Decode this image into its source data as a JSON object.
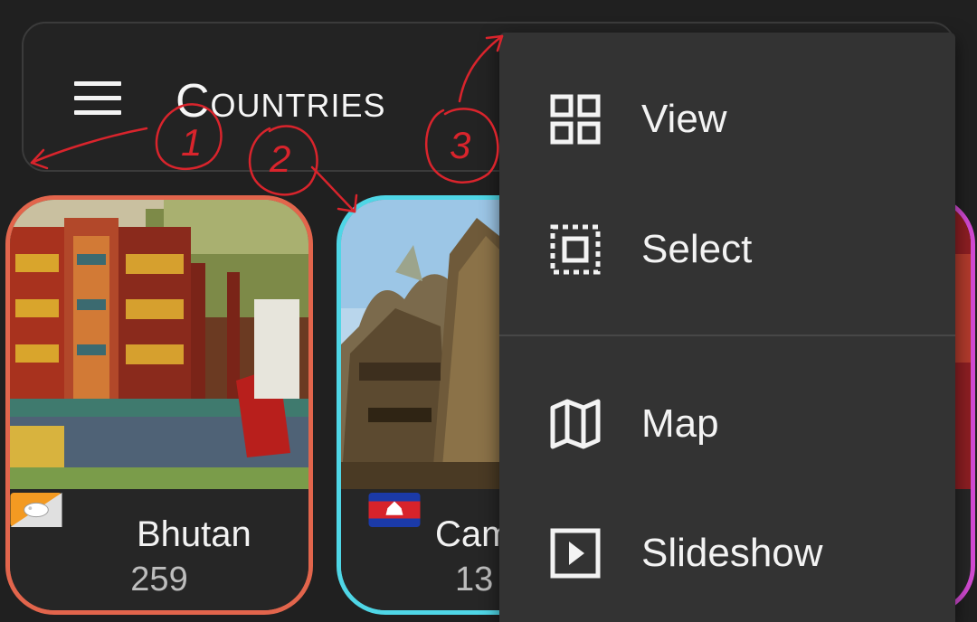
{
  "app_bar": {
    "menu_icon": "hamburger-menu-icon",
    "title": "Countries"
  },
  "cards": [
    {
      "name": "Bhutan",
      "count": "259",
      "flag": "bhutan-flag",
      "border_color": "#e2654c"
    },
    {
      "name": "Cam",
      "count": "13",
      "flag": "cambodia-flag",
      "border_color": "#4fd6e6"
    },
    {
      "name": "",
      "count": "",
      "flag": "",
      "border_color": "#d24ad3"
    }
  ],
  "menu": {
    "items": [
      {
        "label": "View",
        "icon": "grid-view-icon"
      },
      {
        "label": "Select",
        "icon": "select-box-icon"
      },
      {
        "label": "Map",
        "icon": "map-icon"
      },
      {
        "label": "Slideshow",
        "icon": "slideshow-play-icon"
      }
    ]
  },
  "annotations": {
    "labels": [
      "1",
      "2",
      "3"
    ],
    "color": "#d9242c"
  },
  "colors": {
    "background": "#202020",
    "menu_background": "#333333",
    "text": "#f1f1f1"
  }
}
